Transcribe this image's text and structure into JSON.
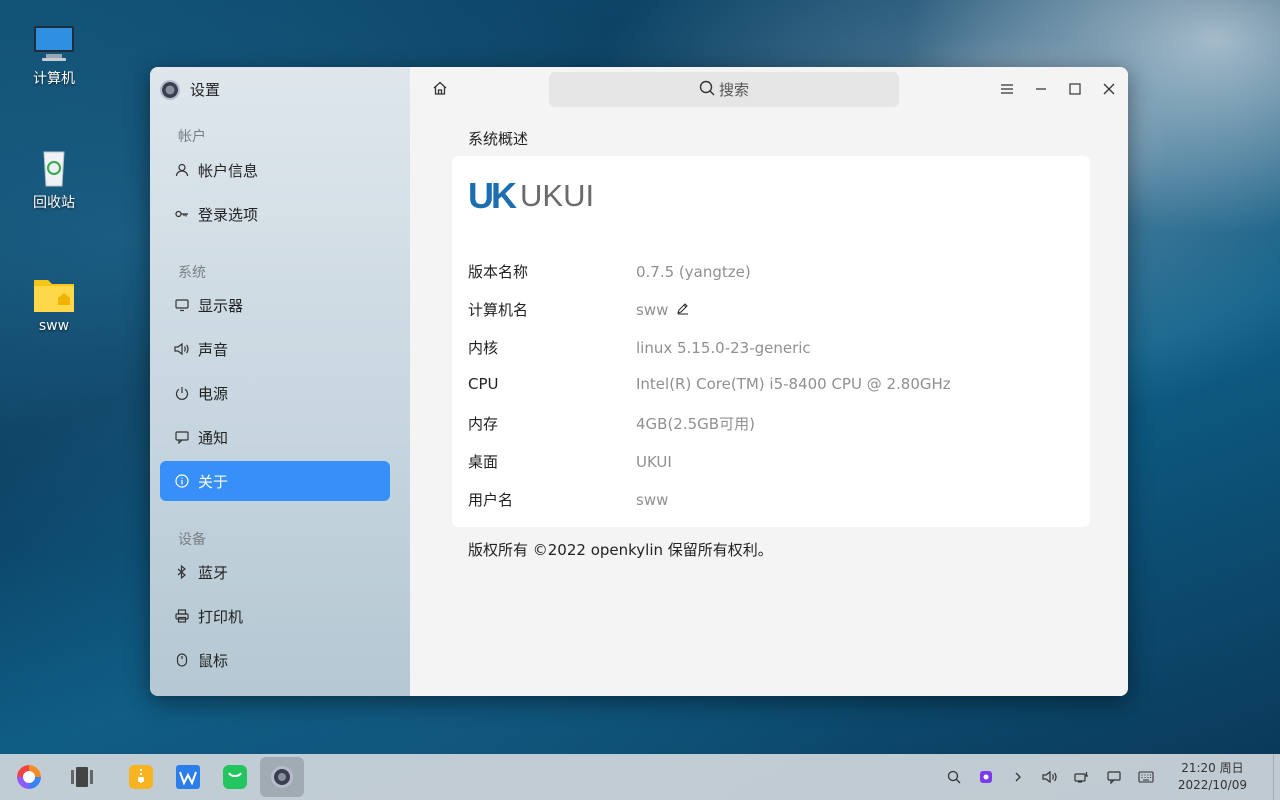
{
  "desktop": {
    "icons": [
      {
        "label": "计算机",
        "icon": "computer-icon"
      },
      {
        "label": "回收站",
        "icon": "trash-icon"
      },
      {
        "label": "sww",
        "icon": "home-folder-icon"
      }
    ]
  },
  "window": {
    "app_title": "设置",
    "sidebar": {
      "groups": [
        {
          "title": "帐户",
          "items": [
            {
              "label": "帐户信息",
              "icon": "user-icon"
            },
            {
              "label": "登录选项",
              "icon": "key-icon"
            }
          ]
        },
        {
          "title": "系统",
          "items": [
            {
              "label": "显示器",
              "icon": "monitor-icon"
            },
            {
              "label": "声音",
              "icon": "speaker-icon"
            },
            {
              "label": "电源",
              "icon": "power-icon"
            },
            {
              "label": "通知",
              "icon": "message-icon"
            },
            {
              "label": "关于",
              "icon": "info-icon",
              "active": true
            }
          ]
        },
        {
          "title": "设备",
          "items": [
            {
              "label": "蓝牙",
              "icon": "bluetooth-icon"
            },
            {
              "label": "打印机",
              "icon": "printer-icon"
            },
            {
              "label": "鼠标",
              "icon": "mouse-icon"
            }
          ]
        }
      ]
    },
    "search": {
      "placeholder": "搜索"
    },
    "section_title": "系统概述",
    "brand": {
      "mark": "UK",
      "text": "UKUI"
    },
    "info": [
      {
        "key": "版本名称",
        "value": "0.7.5 (yangtze)"
      },
      {
        "key": "计算机名",
        "value": "sww",
        "editable": true
      },
      {
        "key": "内核",
        "value": "linux 5.15.0-23-generic"
      },
      {
        "key": "CPU",
        "value": "Intel(R) Core(TM) i5-8400 CPU @ 2.80GHz"
      },
      {
        "key": "内存",
        "value": "4GB(2.5GB可用)"
      },
      {
        "key": "桌面",
        "value": "UKUI"
      },
      {
        "key": "用户名",
        "value": "sww"
      }
    ],
    "copyright": "版权所有 ©2022 openkylin 保留所有权利。"
  },
  "taskbar": {
    "clock_time": "21:20 周日",
    "clock_date": "2022/10/09"
  },
  "colors": {
    "accent": "#3790fa",
    "brand_blue": "#1b6fb0"
  }
}
